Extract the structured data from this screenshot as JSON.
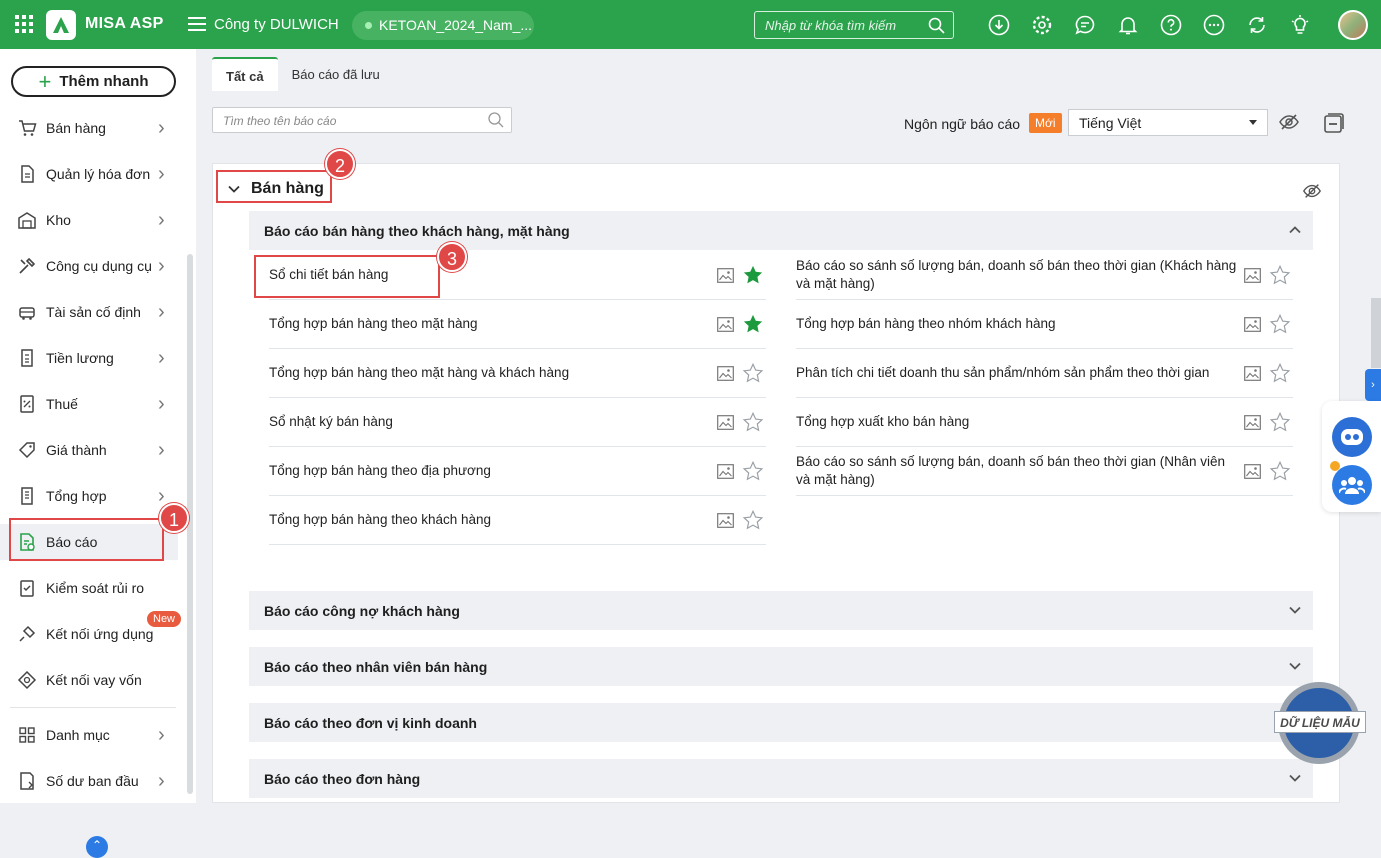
{
  "header": {
    "brand": "MISA ASP",
    "company": "Công ty DULWICH",
    "database": "KETOAN_2024_Nam_...",
    "search_placeholder": "Nhập từ khóa tìm kiếm",
    "icons": [
      "download-icon",
      "settings-icon",
      "chat-icon",
      "bell-icon",
      "help-icon",
      "more-icon",
      "sync-icon",
      "bulb-icon"
    ]
  },
  "sidebar": {
    "quick_add": "Thêm nhanh",
    "items": [
      {
        "label": "Bán hàng",
        "icon": "cart-icon"
      },
      {
        "label": "Quản lý hóa đơn",
        "icon": "invoice-icon"
      },
      {
        "label": "Kho",
        "icon": "warehouse-icon"
      },
      {
        "label": "Công cụ dụng cụ",
        "icon": "tools-icon"
      },
      {
        "label": "Tài sản cố định",
        "icon": "car-icon"
      },
      {
        "label": "Tiền lương",
        "icon": "salary-icon"
      },
      {
        "label": "Thuế",
        "icon": "tax-icon"
      },
      {
        "label": "Giá thành",
        "icon": "price-tag-icon"
      },
      {
        "label": "Tổng hợp",
        "icon": "summary-icon"
      },
      {
        "label": "Báo cáo",
        "icon": "report-icon"
      },
      {
        "label": "Kiểm soát rủi ro",
        "icon": "risk-icon"
      },
      {
        "label": "Kết nối ứng dụng",
        "icon": "plug-icon"
      },
      {
        "label": "Kết nối vay vốn",
        "icon": "loan-icon"
      },
      {
        "label": "Danh mục",
        "icon": "catalog-icon"
      },
      {
        "label": "Số dư ban đầu",
        "icon": "balance-icon"
      }
    ],
    "new_badge": "New"
  },
  "tabs": [
    "Tất cả",
    "Báo cáo đã lưu"
  ],
  "toolbar": {
    "search_placeholder": "Tìm theo tên báo cáo",
    "language_label": "Ngôn ngữ báo cáo",
    "new_badge": "Mới",
    "language_value": "Tiếng Việt"
  },
  "section": {
    "title": "Bán hàng",
    "groups": [
      {
        "title": "Báo cáo bán hàng theo khách hàng, mặt hàng",
        "left": [
          {
            "label": "Sổ chi tiết bán hàng",
            "starred": true
          },
          {
            "label": "Tổng hợp bán hàng theo mặt hàng",
            "starred": true
          },
          {
            "label": "Tổng hợp bán hàng theo mặt hàng và khách hàng",
            "starred": false
          },
          {
            "label": "Sổ nhật ký bán hàng",
            "starred": false
          },
          {
            "label": "Tổng hợp bán hàng theo địa phương",
            "starred": false
          },
          {
            "label": "Tổng hợp bán hàng theo khách hàng",
            "starred": false
          }
        ],
        "right": [
          {
            "label": "Báo cáo so sánh số lượng bán, doanh số bán theo thời gian (Khách hàng và mặt hàng)",
            "starred": false
          },
          {
            "label": "Tổng hợp bán hàng theo nhóm khách hàng",
            "starred": false
          },
          {
            "label": "Phân tích chi tiết doanh thu sản phẩm/nhóm sản phẩm theo thời gian",
            "starred": false
          },
          {
            "label": "Tổng hợp xuất kho bán hàng",
            "starred": false
          },
          {
            "label": "Báo cáo so sánh số lượng bán, doanh số bán theo thời gian (Nhân viên và mặt hàng)",
            "starred": false
          }
        ]
      },
      {
        "title": "Báo cáo công nợ khách hàng"
      },
      {
        "title": "Báo cáo theo nhân viên bán hàng"
      },
      {
        "title": "Báo cáo theo đơn vị kinh doanh"
      },
      {
        "title": "Báo cáo theo đơn hàng"
      }
    ]
  },
  "markers": [
    "1",
    "2",
    "3"
  ],
  "stamp_text": "DỮ LIỆU MẪU",
  "colors": {
    "brand_green": "#2ba24c",
    "star_green": "#1e9a3e",
    "highlight_red": "#e04848",
    "badge_orange": "#f47e2a"
  }
}
